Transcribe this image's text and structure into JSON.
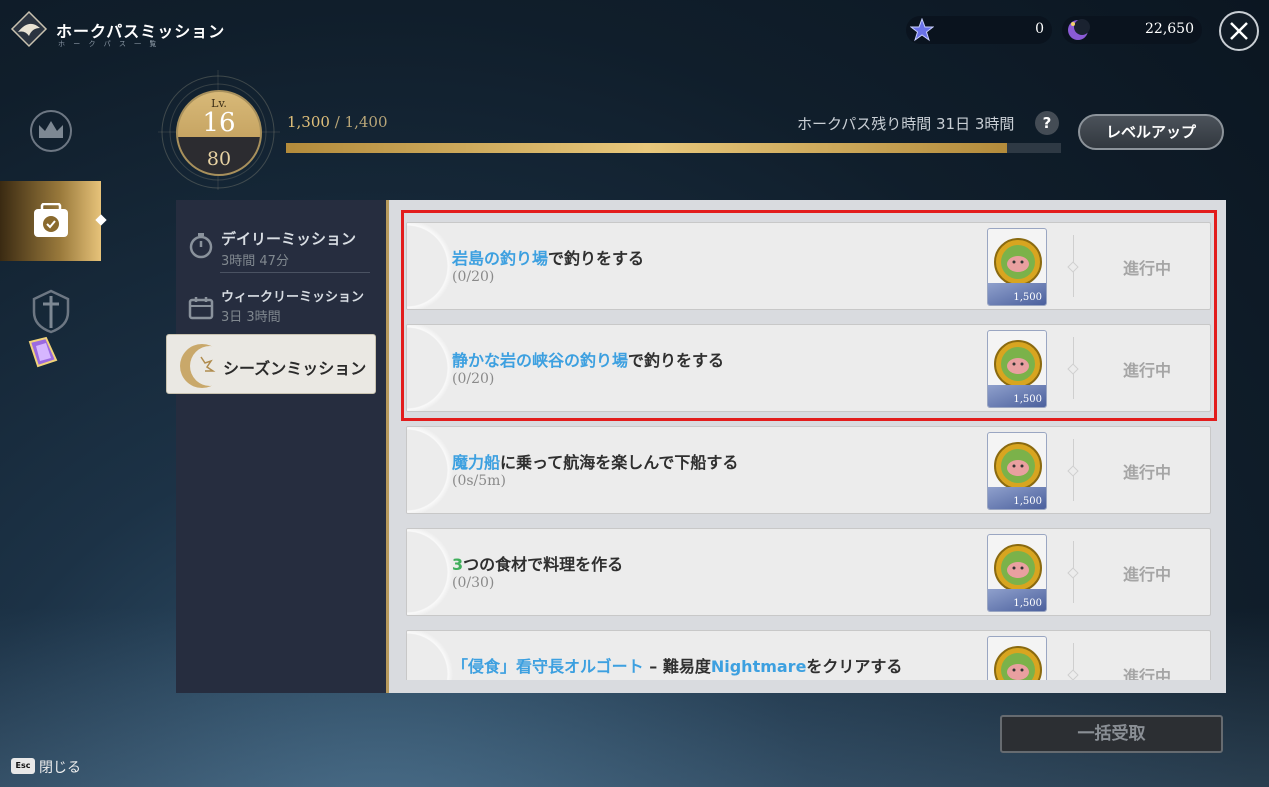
{
  "header": {
    "title": "ホークパスミッション",
    "subtitle": "ホ ー ク パ ス 一 覧",
    "currencies": [
      {
        "icon": "star-currency-icon",
        "value": "0"
      },
      {
        "icon": "moon-currency-icon",
        "value": "22,650"
      }
    ]
  },
  "level": {
    "lv_label": "Lv.",
    "lv_value": "16",
    "sub_value": "80",
    "xp_current": "1,300",
    "xp_total": "/ 1,400",
    "xp_progress": 0.93,
    "remaining_label": "ホークパス残り時間 31日 3時間",
    "help_label": "?",
    "levelup_label": "レベルアップ"
  },
  "tabs": {
    "daily": {
      "label": "デイリーミッション",
      "time": "3時間 47分"
    },
    "weekly": {
      "label": "ウィークリーミッション",
      "time": "3日 3時間"
    },
    "season": {
      "label": "シーズンミッション"
    }
  },
  "missions": [
    {
      "title_hl": "岩島の釣り場",
      "title_rest": "で釣りをする",
      "progress": "(0/20)",
      "reward": "1,500",
      "status": "進行中"
    },
    {
      "title_hl": "静かな岩の峡谷の釣り場",
      "title_rest": "で釣りをする",
      "progress": "(0/20)",
      "reward": "1,500",
      "status": "進行中"
    },
    {
      "title_hl": "魔力船",
      "title_rest": "に乗って航海を楽しんで下船する",
      "progress": "(0s/5m)",
      "reward": "1,500",
      "status": "進行中"
    },
    {
      "title_hl": "3",
      "title_rest": "つの食材で料理を作る",
      "progress": "(0/30)",
      "reward": "1,500",
      "status": "進行中"
    },
    {
      "title_hl": "「侵食」看守長オルゴート",
      "title_mid": " – 難易度",
      "title_hl2": "Nightmare",
      "title_rest": "をクリアする",
      "progress": "",
      "reward": "",
      "status": "進行中"
    }
  ],
  "footer": {
    "collect_all": "一括受取",
    "esc_key": "Esc",
    "close_label": "閉じる"
  },
  "colors": {
    "accent_gold": "#e0c07a",
    "highlight_blue": "#3da0e0",
    "highlight_green": "#3fae5b",
    "box_red": "#e21c1c"
  }
}
